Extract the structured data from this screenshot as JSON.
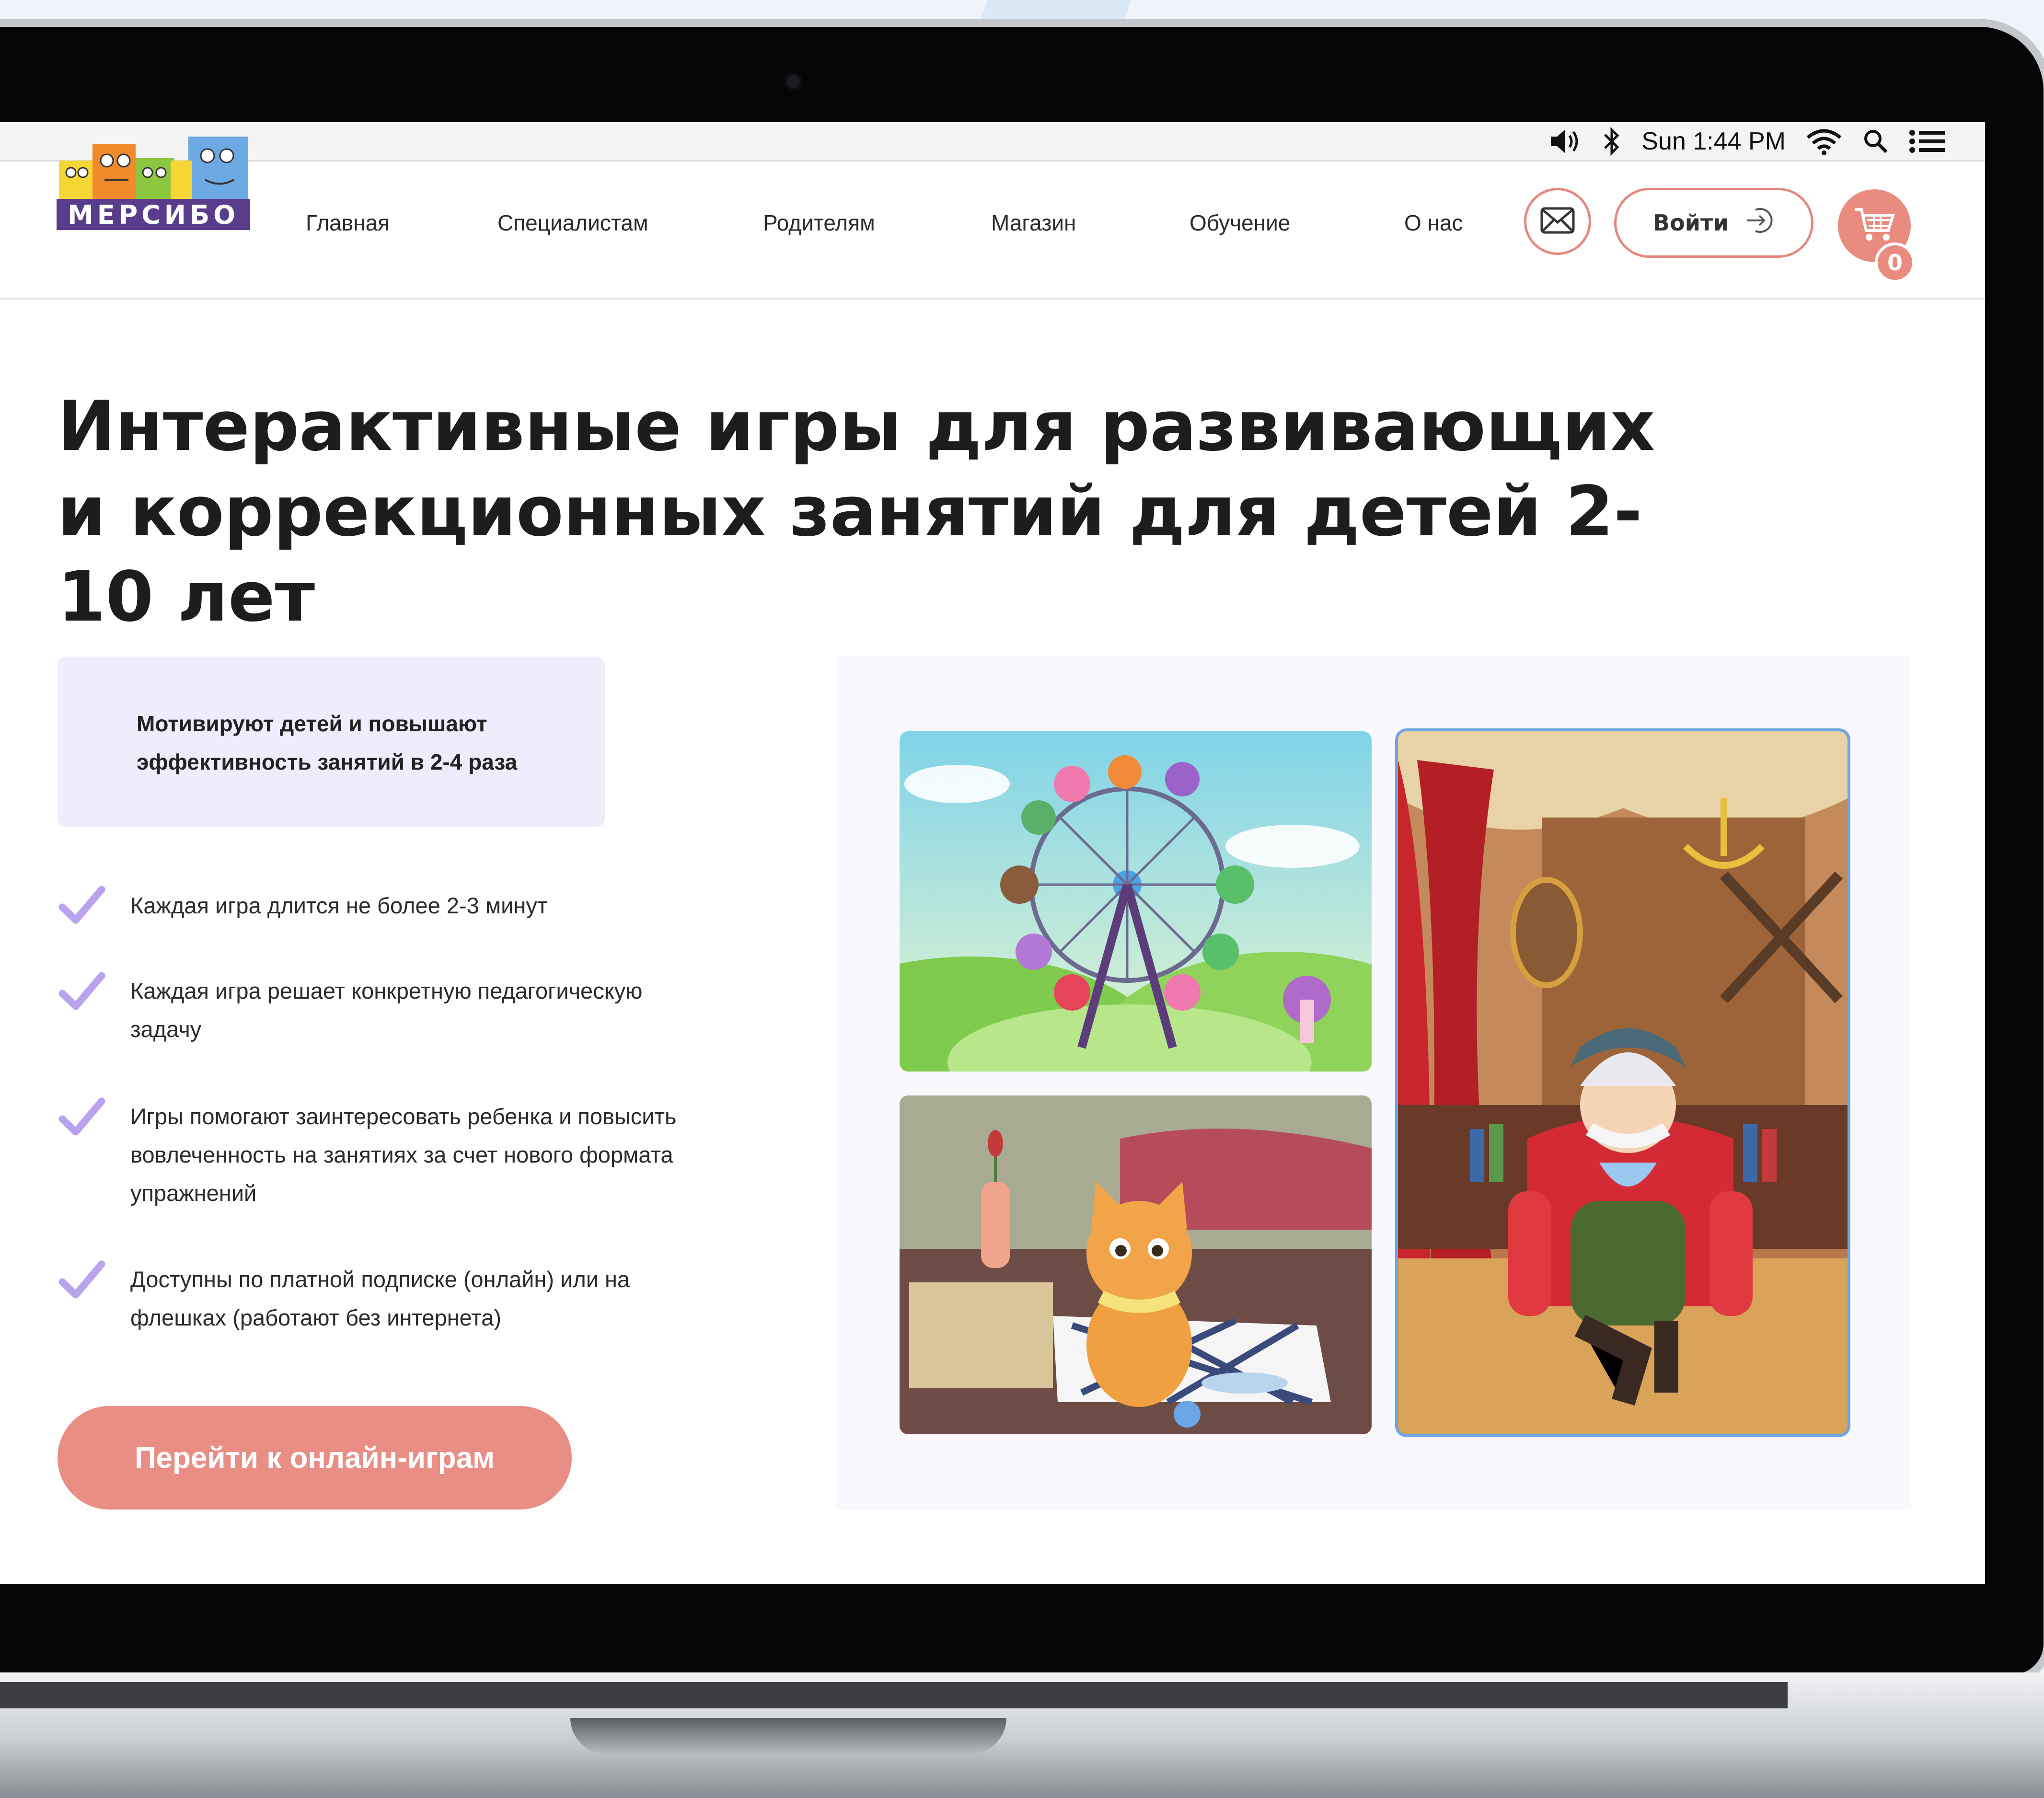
{
  "menubar": {
    "clock": "Sun 1:44 PM",
    "icons": [
      "volume-icon",
      "bluetooth-icon",
      "wifi-icon",
      "spotlight-search-icon",
      "control-center-icon"
    ]
  },
  "header": {
    "logo_text": "МЕРСИБО",
    "nav": [
      "Главная",
      "Специалистам",
      "Родителям",
      "Магазин",
      "Обучение",
      "О нас"
    ],
    "login_label": "Войти",
    "cart_count": "0"
  },
  "hero": {
    "title": "Интерактивные игры для развивающих и коррекционных занятий для детей 2-10 лет",
    "highlight": "Мотивируют детей и повышают эффективность занятий в 2-4 раза",
    "features": [
      "Каждая игра длится не более 2-3 минут",
      "Каждая игра решает конкретную педагогическую задачу",
      "Игры помогают заинтересовать ребенка и повысить вовлеченность на занятиях за счет нового формата упражнений",
      "Доступны по платной подписке (онлайн) или на флешках (работают без интернета)"
    ],
    "cta_label": "Перейти к онлайн-играм"
  },
  "gallery": {
    "images": [
      "ferris-wheel-game-screenshot",
      "kitten-room-game-screenshot",
      "baron-armchair-game-screenshot"
    ]
  },
  "colors": {
    "accent": "#e98e85",
    "highlight_bg": "#efecfc",
    "check": "#b9a2ee"
  }
}
